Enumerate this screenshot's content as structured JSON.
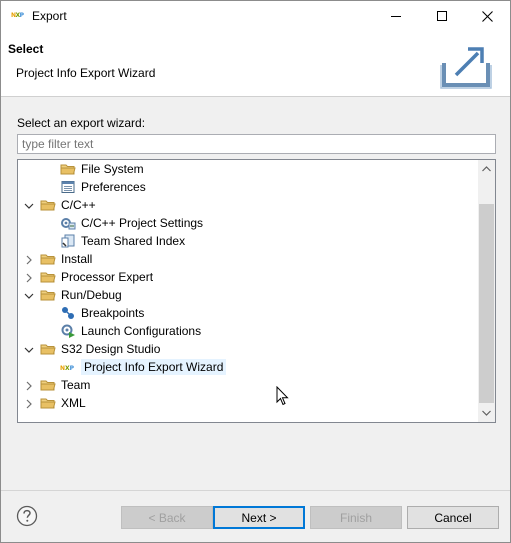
{
  "window": {
    "app_icon_text": "NXP",
    "title": "Export"
  },
  "banner": {
    "title": "Select",
    "description": "Project Info Export Wizard",
    "icon": "export-icon"
  },
  "content": {
    "prompt": "Select an export wizard:",
    "filter_placeholder": "type filter text",
    "tree": [
      {
        "label": "File System",
        "level": 1,
        "icon": "folder-icon",
        "expandable": false
      },
      {
        "label": "Preferences",
        "level": 1,
        "icon": "preferences-icon",
        "expandable": false
      },
      {
        "label": "C/C++",
        "level": 0,
        "icon": "folder-icon",
        "expandable": true,
        "expanded": true
      },
      {
        "label": "C/C++ Project Settings",
        "level": 1,
        "icon": "project-settings-icon",
        "expandable": false
      },
      {
        "label": "Team Shared Index",
        "level": 1,
        "icon": "shared-index-icon",
        "expandable": false
      },
      {
        "label": "Install",
        "level": 0,
        "icon": "folder-icon",
        "expandable": true,
        "expanded": false
      },
      {
        "label": "Processor Expert",
        "level": 0,
        "icon": "folder-icon",
        "expandable": true,
        "expanded": false
      },
      {
        "label": "Run/Debug",
        "level": 0,
        "icon": "folder-icon",
        "expandable": true,
        "expanded": true
      },
      {
        "label": "Breakpoints",
        "level": 1,
        "icon": "breakpoints-icon",
        "expandable": false
      },
      {
        "label": "Launch Configurations",
        "level": 1,
        "icon": "launch-config-icon",
        "expandable": false
      },
      {
        "label": "S32 Design Studio",
        "level": 0,
        "icon": "folder-icon",
        "expandable": true,
        "expanded": true
      },
      {
        "label": "Project Info Export Wizard",
        "level": 1,
        "icon": "nxp-icon",
        "expandable": false,
        "selected": true
      },
      {
        "label": "Team",
        "level": 0,
        "icon": "folder-icon",
        "expandable": true,
        "expanded": false
      },
      {
        "label": "XML",
        "level": 0,
        "icon": "folder-icon",
        "expandable": true,
        "expanded": false
      }
    ]
  },
  "footer": {
    "help_icon": "help-icon",
    "back_label": "< Back",
    "next_label": "Next >",
    "finish_label": "Finish",
    "cancel_label": "Cancel"
  },
  "colors": {
    "selection": "#e5f3ff",
    "folder": "#dcb35c",
    "default_button_border": "#0078d7"
  }
}
